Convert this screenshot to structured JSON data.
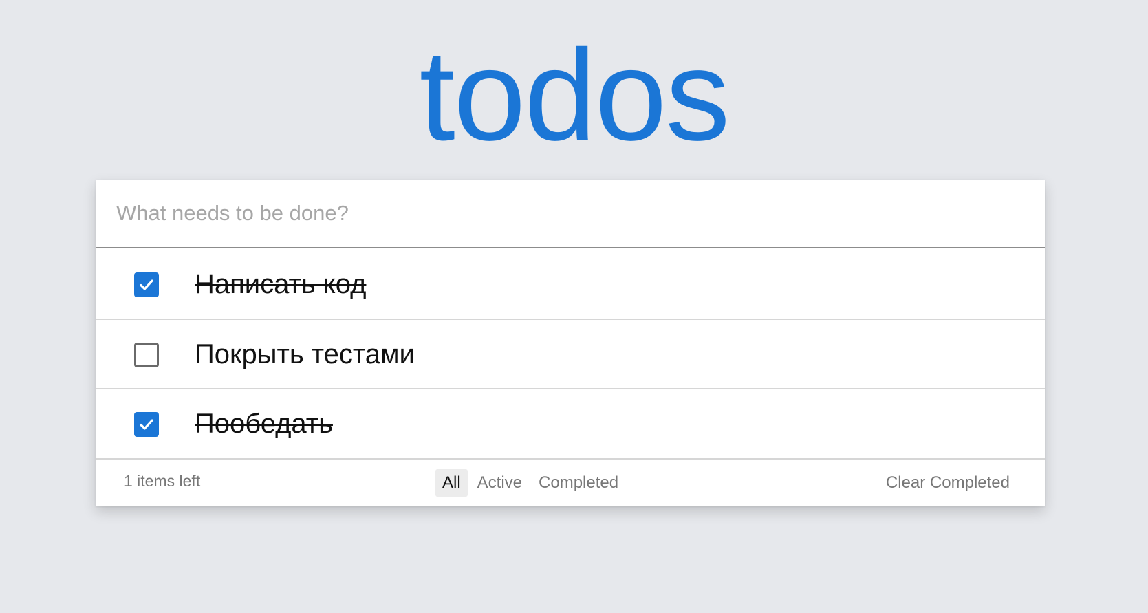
{
  "header": {
    "title": "todos"
  },
  "new_todo": {
    "placeholder": "What needs to be done?",
    "value": ""
  },
  "todos": [
    {
      "label": "Написать код",
      "completed": true
    },
    {
      "label": "Покрыть тестами",
      "completed": false
    },
    {
      "label": "Пообедать",
      "completed": true
    }
  ],
  "footer": {
    "items_left": "1 items left",
    "filters": [
      {
        "label": "All",
        "selected": true
      },
      {
        "label": "Active",
        "selected": false
      },
      {
        "label": "Completed",
        "selected": false
      }
    ],
    "clear_completed": "Clear Completed"
  },
  "colors": {
    "background": "#e6e8ec",
    "accent": "#1b76d6",
    "card": "#ffffff"
  },
  "icons": {
    "checked": "check-icon"
  }
}
